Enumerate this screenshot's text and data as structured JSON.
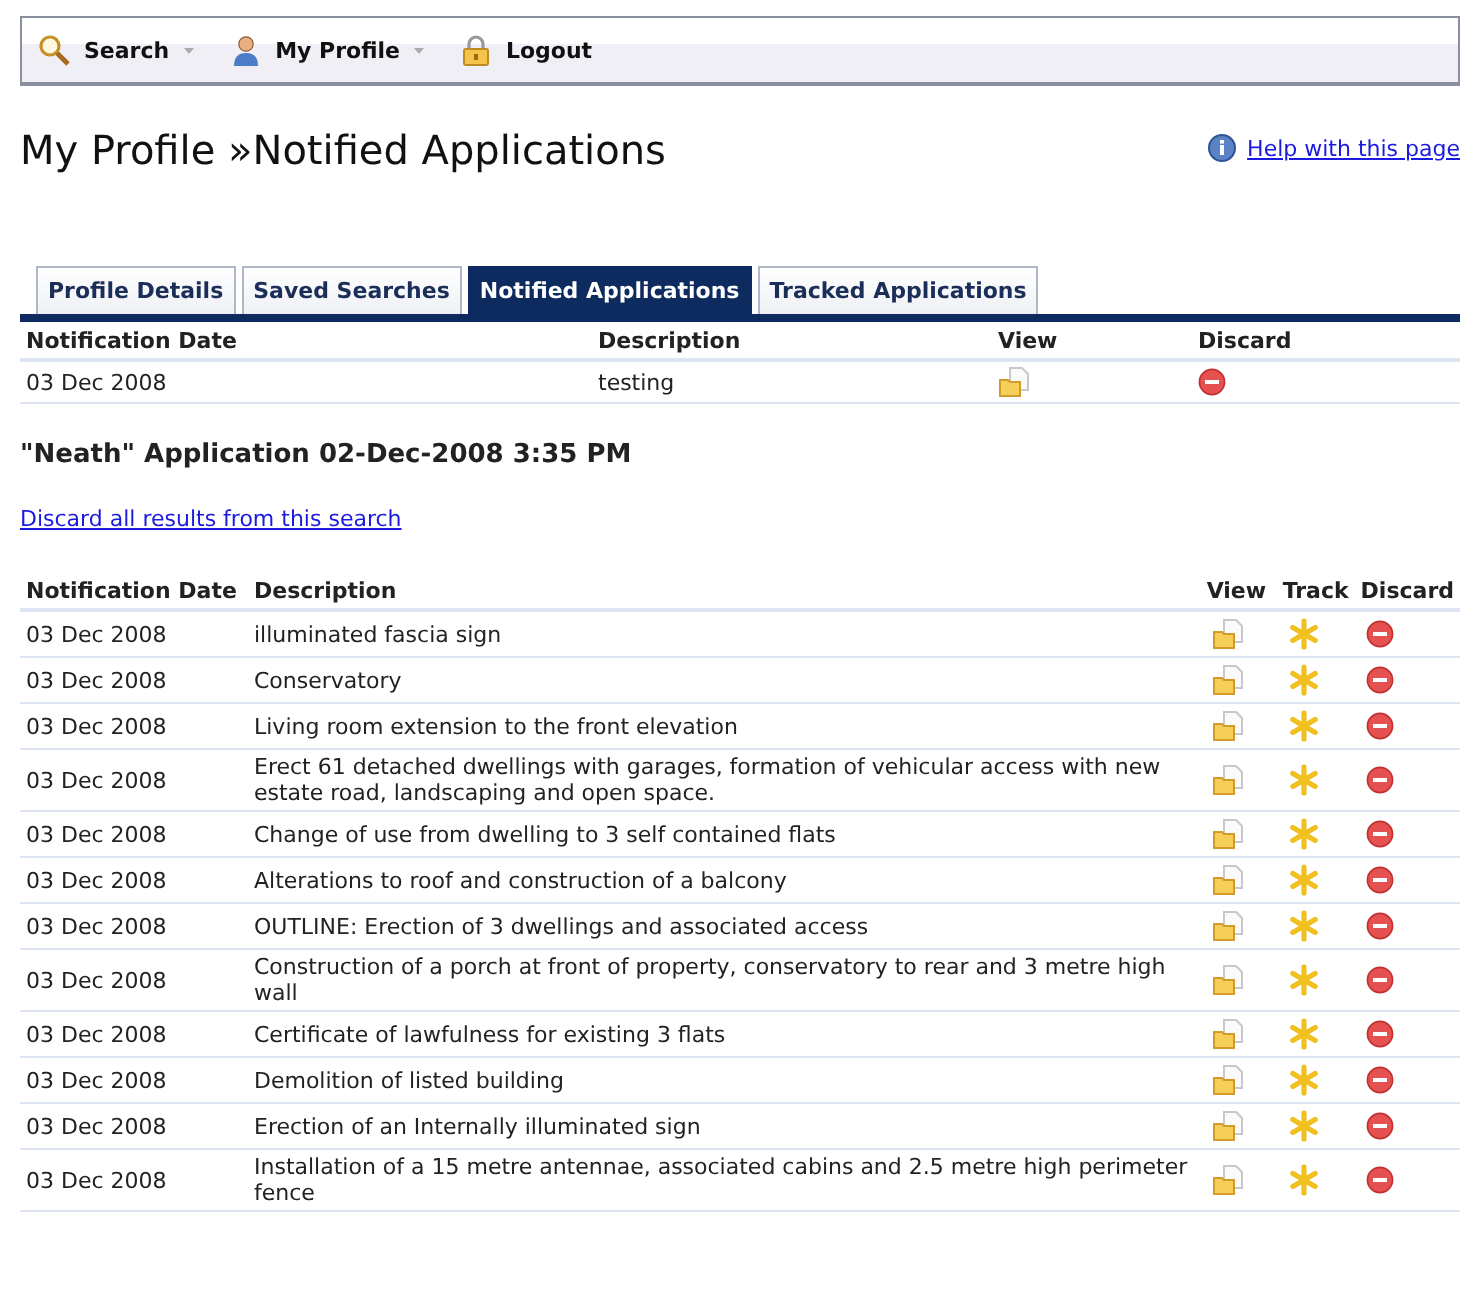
{
  "toolbar": {
    "items": [
      {
        "kind": "search",
        "label": "Search",
        "has_menu": true
      },
      {
        "kind": "profile",
        "label": "My Profile",
        "has_menu": true
      },
      {
        "kind": "logout",
        "label": "Logout",
        "has_menu": false
      }
    ]
  },
  "page_title": "My Profile »Notified Applications",
  "help_link": "Help with this page",
  "tabs": [
    {
      "label": "Profile Details",
      "selected": false
    },
    {
      "label": "Saved Searches",
      "selected": false
    },
    {
      "label": "Notified Applications",
      "selected": true
    },
    {
      "label": "Tracked Applications",
      "selected": false
    }
  ],
  "searches_table": {
    "columns": [
      "Notification Date",
      "Description",
      "View",
      "Discard"
    ],
    "rows": [
      {
        "date": "03 Dec 2008",
        "description": "testing"
      }
    ]
  },
  "search_heading": "\"Neath\" Application 02-Dec-2008 3:35 PM",
  "discard_all_link": "Discard all results from this search",
  "results_table": {
    "columns": [
      "Notification Date",
      "Description",
      "View",
      "Track",
      "Discard"
    ],
    "rows": [
      {
        "date": "03 Dec 2008",
        "description": "illuminated fascia sign"
      },
      {
        "date": "03 Dec 2008",
        "description": "Conservatory"
      },
      {
        "date": "03 Dec 2008",
        "description": "Living room extension to the front elevation"
      },
      {
        "date": "03 Dec 2008",
        "description": "Erect 61 detached dwellings with garages, formation of vehicular access with new estate road, landscaping and open space."
      },
      {
        "date": "03 Dec 2008",
        "description": "Change of use from dwelling to 3 self contained flats"
      },
      {
        "date": "03 Dec 2008",
        "description": "Alterations to roof and construction of a balcony"
      },
      {
        "date": "03 Dec 2008",
        "description": "OUTLINE: Erection of 3 dwellings and associated access"
      },
      {
        "date": "03 Dec 2008",
        "description": "Construction of a porch at front of property, conservatory to rear and 3 metre high wall"
      },
      {
        "date": "03 Dec 2008",
        "description": "Certificate of lawfulness for existing 3 flats"
      },
      {
        "date": "03 Dec 2008",
        "description": "Demolition of listed building"
      },
      {
        "date": "03 Dec 2008",
        "description": "Erection of an Internally illuminated sign"
      },
      {
        "date": "03 Dec 2008",
        "description": "Installation of a 15 metre antennae, associated cabins and 2.5 metre high perimeter fence"
      }
    ]
  }
}
